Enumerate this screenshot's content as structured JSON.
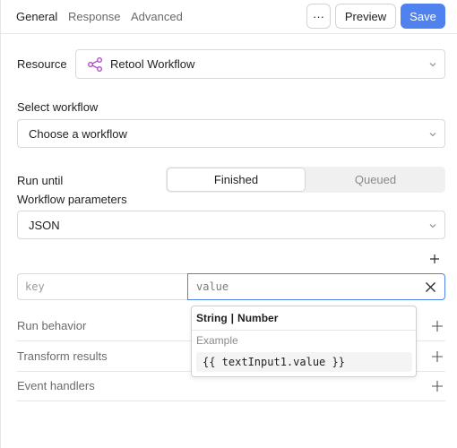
{
  "tabs": [
    {
      "label": "General",
      "active": true
    },
    {
      "label": "Response",
      "active": false
    },
    {
      "label": "Advanced",
      "active": false
    }
  ],
  "toolbar": {
    "more_label": "···",
    "preview_label": "Preview",
    "save_label": "Save"
  },
  "resource": {
    "label": "Resource",
    "value": "Retool Workflow",
    "icon": "workflow-icon",
    "icon_color": "#b04fc9"
  },
  "workflow": {
    "label": "Select workflow",
    "placeholder": "Choose a workflow"
  },
  "run_until": {
    "label": "Run until",
    "options": [
      "Finished",
      "Queued"
    ],
    "selected": "Finished"
  },
  "parameters": {
    "label": "Workflow parameters",
    "format": "JSON",
    "key_placeholder": "key",
    "value_placeholder": "value"
  },
  "sections": [
    {
      "title": "Run behavior"
    },
    {
      "title": "Transform results"
    },
    {
      "title": "Event handlers"
    }
  ],
  "popover": {
    "type_a": "String",
    "separator": "|",
    "type_b": "Number",
    "example_label": "Example",
    "example_code": "{{ textInput1.value }}"
  },
  "colors": {
    "accent": "#4f82ee",
    "border": "#d9d9d9",
    "muted_text": "#6b6b6b"
  }
}
